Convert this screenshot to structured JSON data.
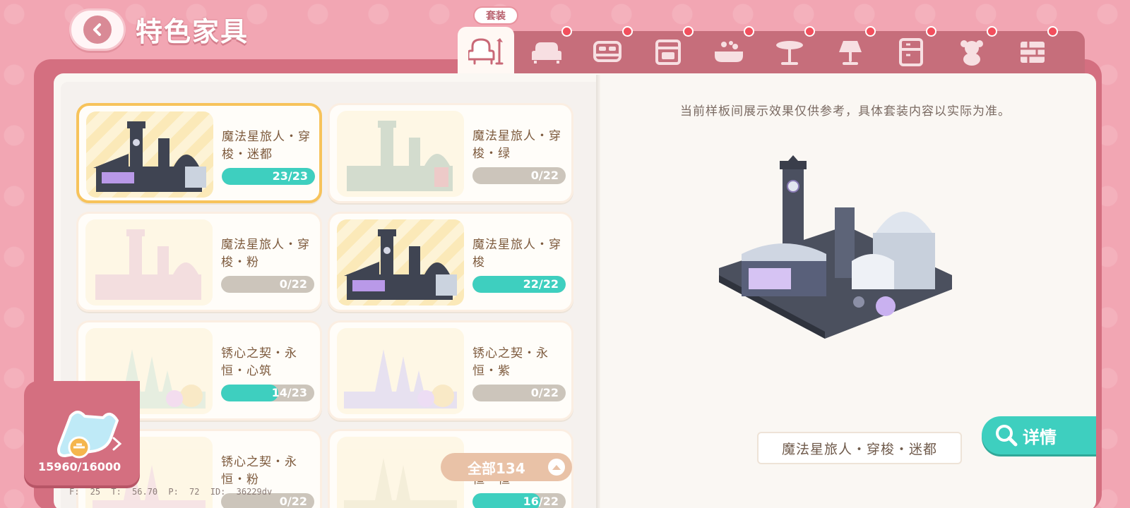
{
  "header": {
    "title": "特色家具"
  },
  "tabs": {
    "suit_label": "套装",
    "items": [
      {
        "icon": "armchair-lamp-icon",
        "active": true,
        "badge": false
      },
      {
        "icon": "sofa-icon",
        "badge": true
      },
      {
        "icon": "bed-icon",
        "badge": true
      },
      {
        "icon": "stove-icon",
        "badge": true
      },
      {
        "icon": "bathtub-icon",
        "badge": true
      },
      {
        "icon": "table-icon",
        "badge": true
      },
      {
        "icon": "lamp-icon",
        "badge": true
      },
      {
        "icon": "cabinet-icon",
        "badge": true
      },
      {
        "icon": "teddy-bear-icon",
        "badge": true
      },
      {
        "icon": "wall-icon",
        "badge": true
      }
    ]
  },
  "cards": [
    {
      "name": "魔法星旅人・穿梭・迷都",
      "progress_text": "23/23",
      "progress": 1.0,
      "selected": true,
      "image": "clock-tower-city-dark"
    },
    {
      "name": "魔法星旅人・穿梭・绿",
      "progress_text": "0/22",
      "progress": 0,
      "image": "clock-tower-city-green"
    },
    {
      "name": "魔法星旅人・穿梭・粉",
      "progress_text": "0/22",
      "progress": 0,
      "image": "clock-tower-city-pink"
    },
    {
      "name": "魔法星旅人・穿梭",
      "progress_text": "22/22",
      "progress": 1.0,
      "image": "clock-tower-city-dark"
    },
    {
      "name": "锈心之契・永恒・心筑",
      "progress_text": "14/23",
      "progress": 0.61,
      "image": "castle-white"
    },
    {
      "name": "锈心之契・永恒・紫",
      "progress_text": "0/22",
      "progress": 0,
      "image": "castle-purple"
    },
    {
      "name": "锈心之契・永恒・粉",
      "progress_text": "0/22",
      "progress": 0,
      "image": "castle-pink"
    },
    {
      "name": "锈心之契・永恒・恒",
      "progress_text": "16/22",
      "progress": 0.73,
      "image": "castle-yellow"
    }
  ],
  "list_footer": {
    "count_label": "全部134"
  },
  "currency": {
    "amount": "15960/16000"
  },
  "debug": {
    "text": "F: 25   T: 56.70   P: 72   ID: 36229dv"
  },
  "preview": {
    "notice": "当前样板间展示效果仅供参考，具体套装内容以实际为准。",
    "name": "魔法星旅人・穿梭・迷都",
    "detail_label": "详情"
  },
  "colors": {
    "accent": "#3ecfbf",
    "frame": "#d46f80",
    "selected_border": "#f7c35b",
    "badge": "#f24f5d"
  }
}
